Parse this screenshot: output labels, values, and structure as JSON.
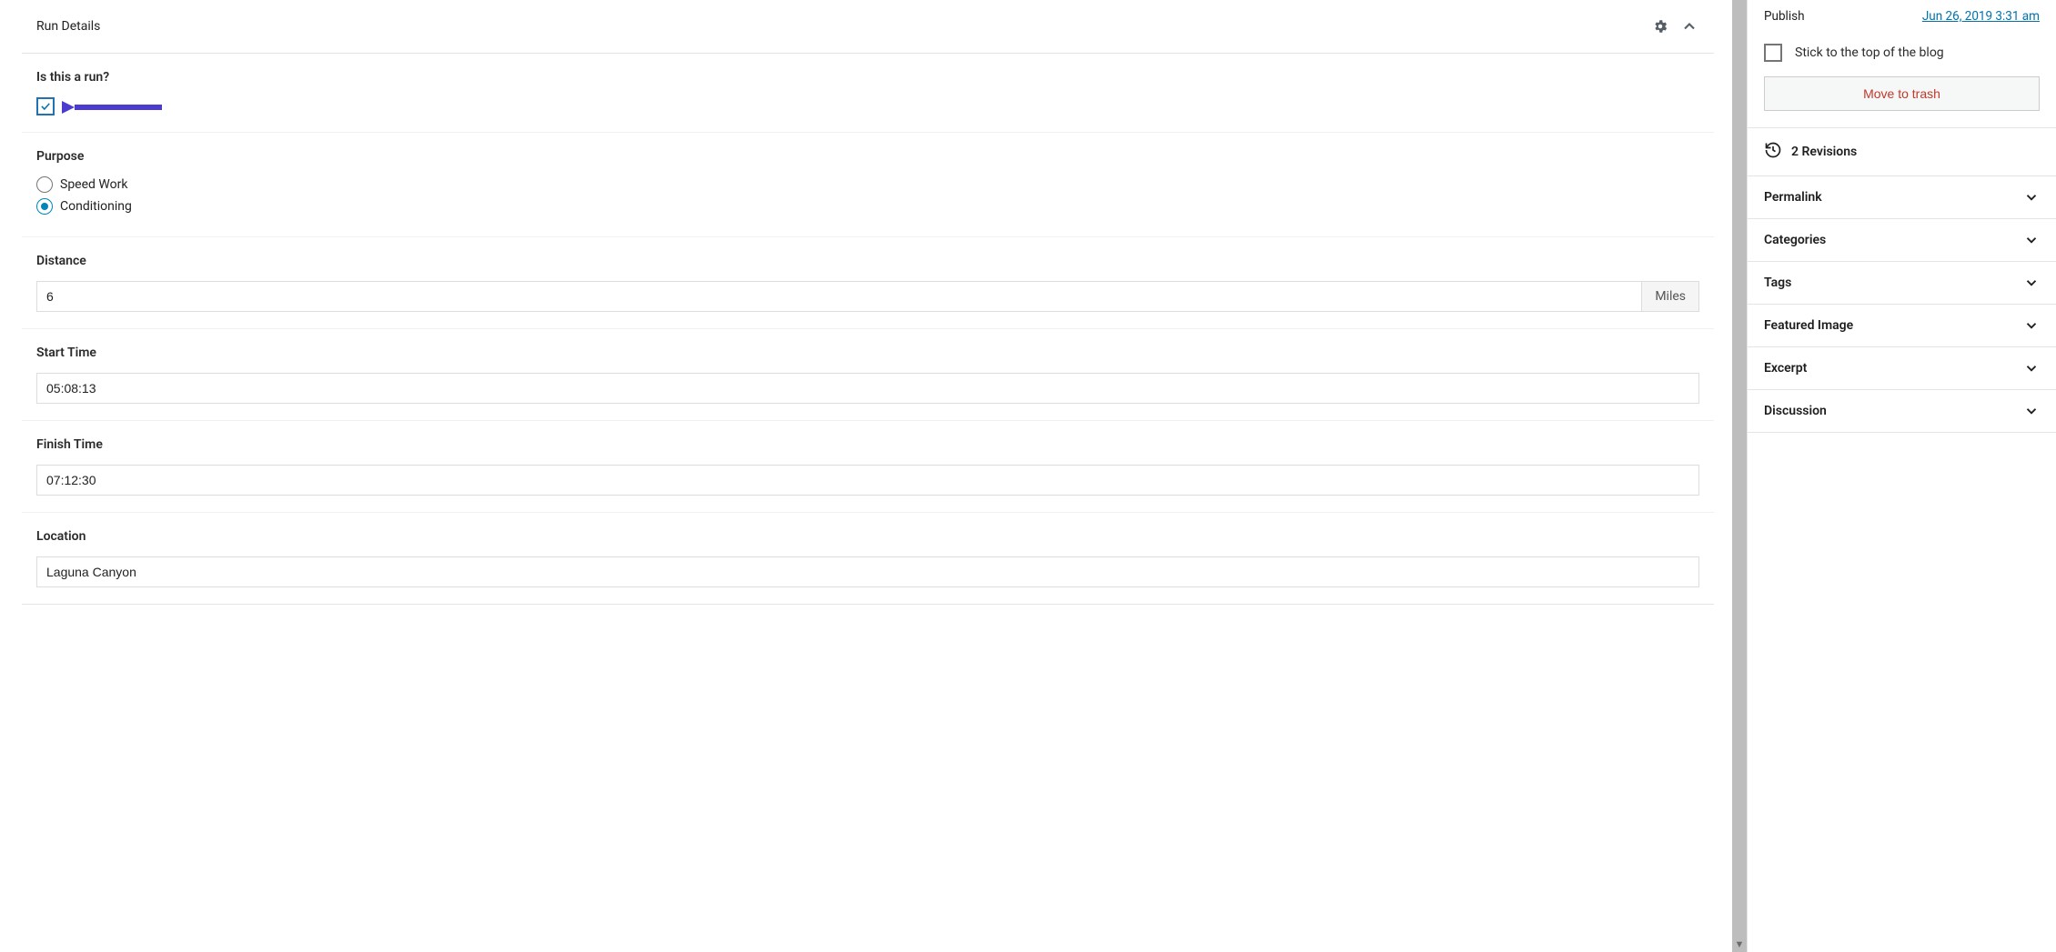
{
  "panel": {
    "title": "Run Details"
  },
  "fields": {
    "is_run": {
      "label": "Is this a run?",
      "checked": true
    },
    "purpose": {
      "label": "Purpose",
      "options": [
        "Speed Work",
        "Conditioning"
      ],
      "selected": "Conditioning"
    },
    "distance": {
      "label": "Distance",
      "value": "6",
      "unit": "Miles"
    },
    "start_time": {
      "label": "Start Time",
      "value": "05:08:13"
    },
    "finish_time": {
      "label": "Finish Time",
      "value": "07:12:30"
    },
    "location": {
      "label": "Location",
      "value": "Laguna Canyon"
    }
  },
  "sidebar": {
    "publish": {
      "label": "Publish",
      "value": "Jun 26, 2019 3:31 am"
    },
    "stick": {
      "label": "Stick to the top of the blog",
      "checked": false
    },
    "trash": "Move to trash",
    "revisions": {
      "count": "2",
      "label": "Revisions"
    },
    "sections": {
      "permalink": "Permalink",
      "categories": "Categories",
      "tags": "Tags",
      "featured_image": "Featured Image",
      "excerpt": "Excerpt",
      "discussion": "Discussion"
    }
  }
}
